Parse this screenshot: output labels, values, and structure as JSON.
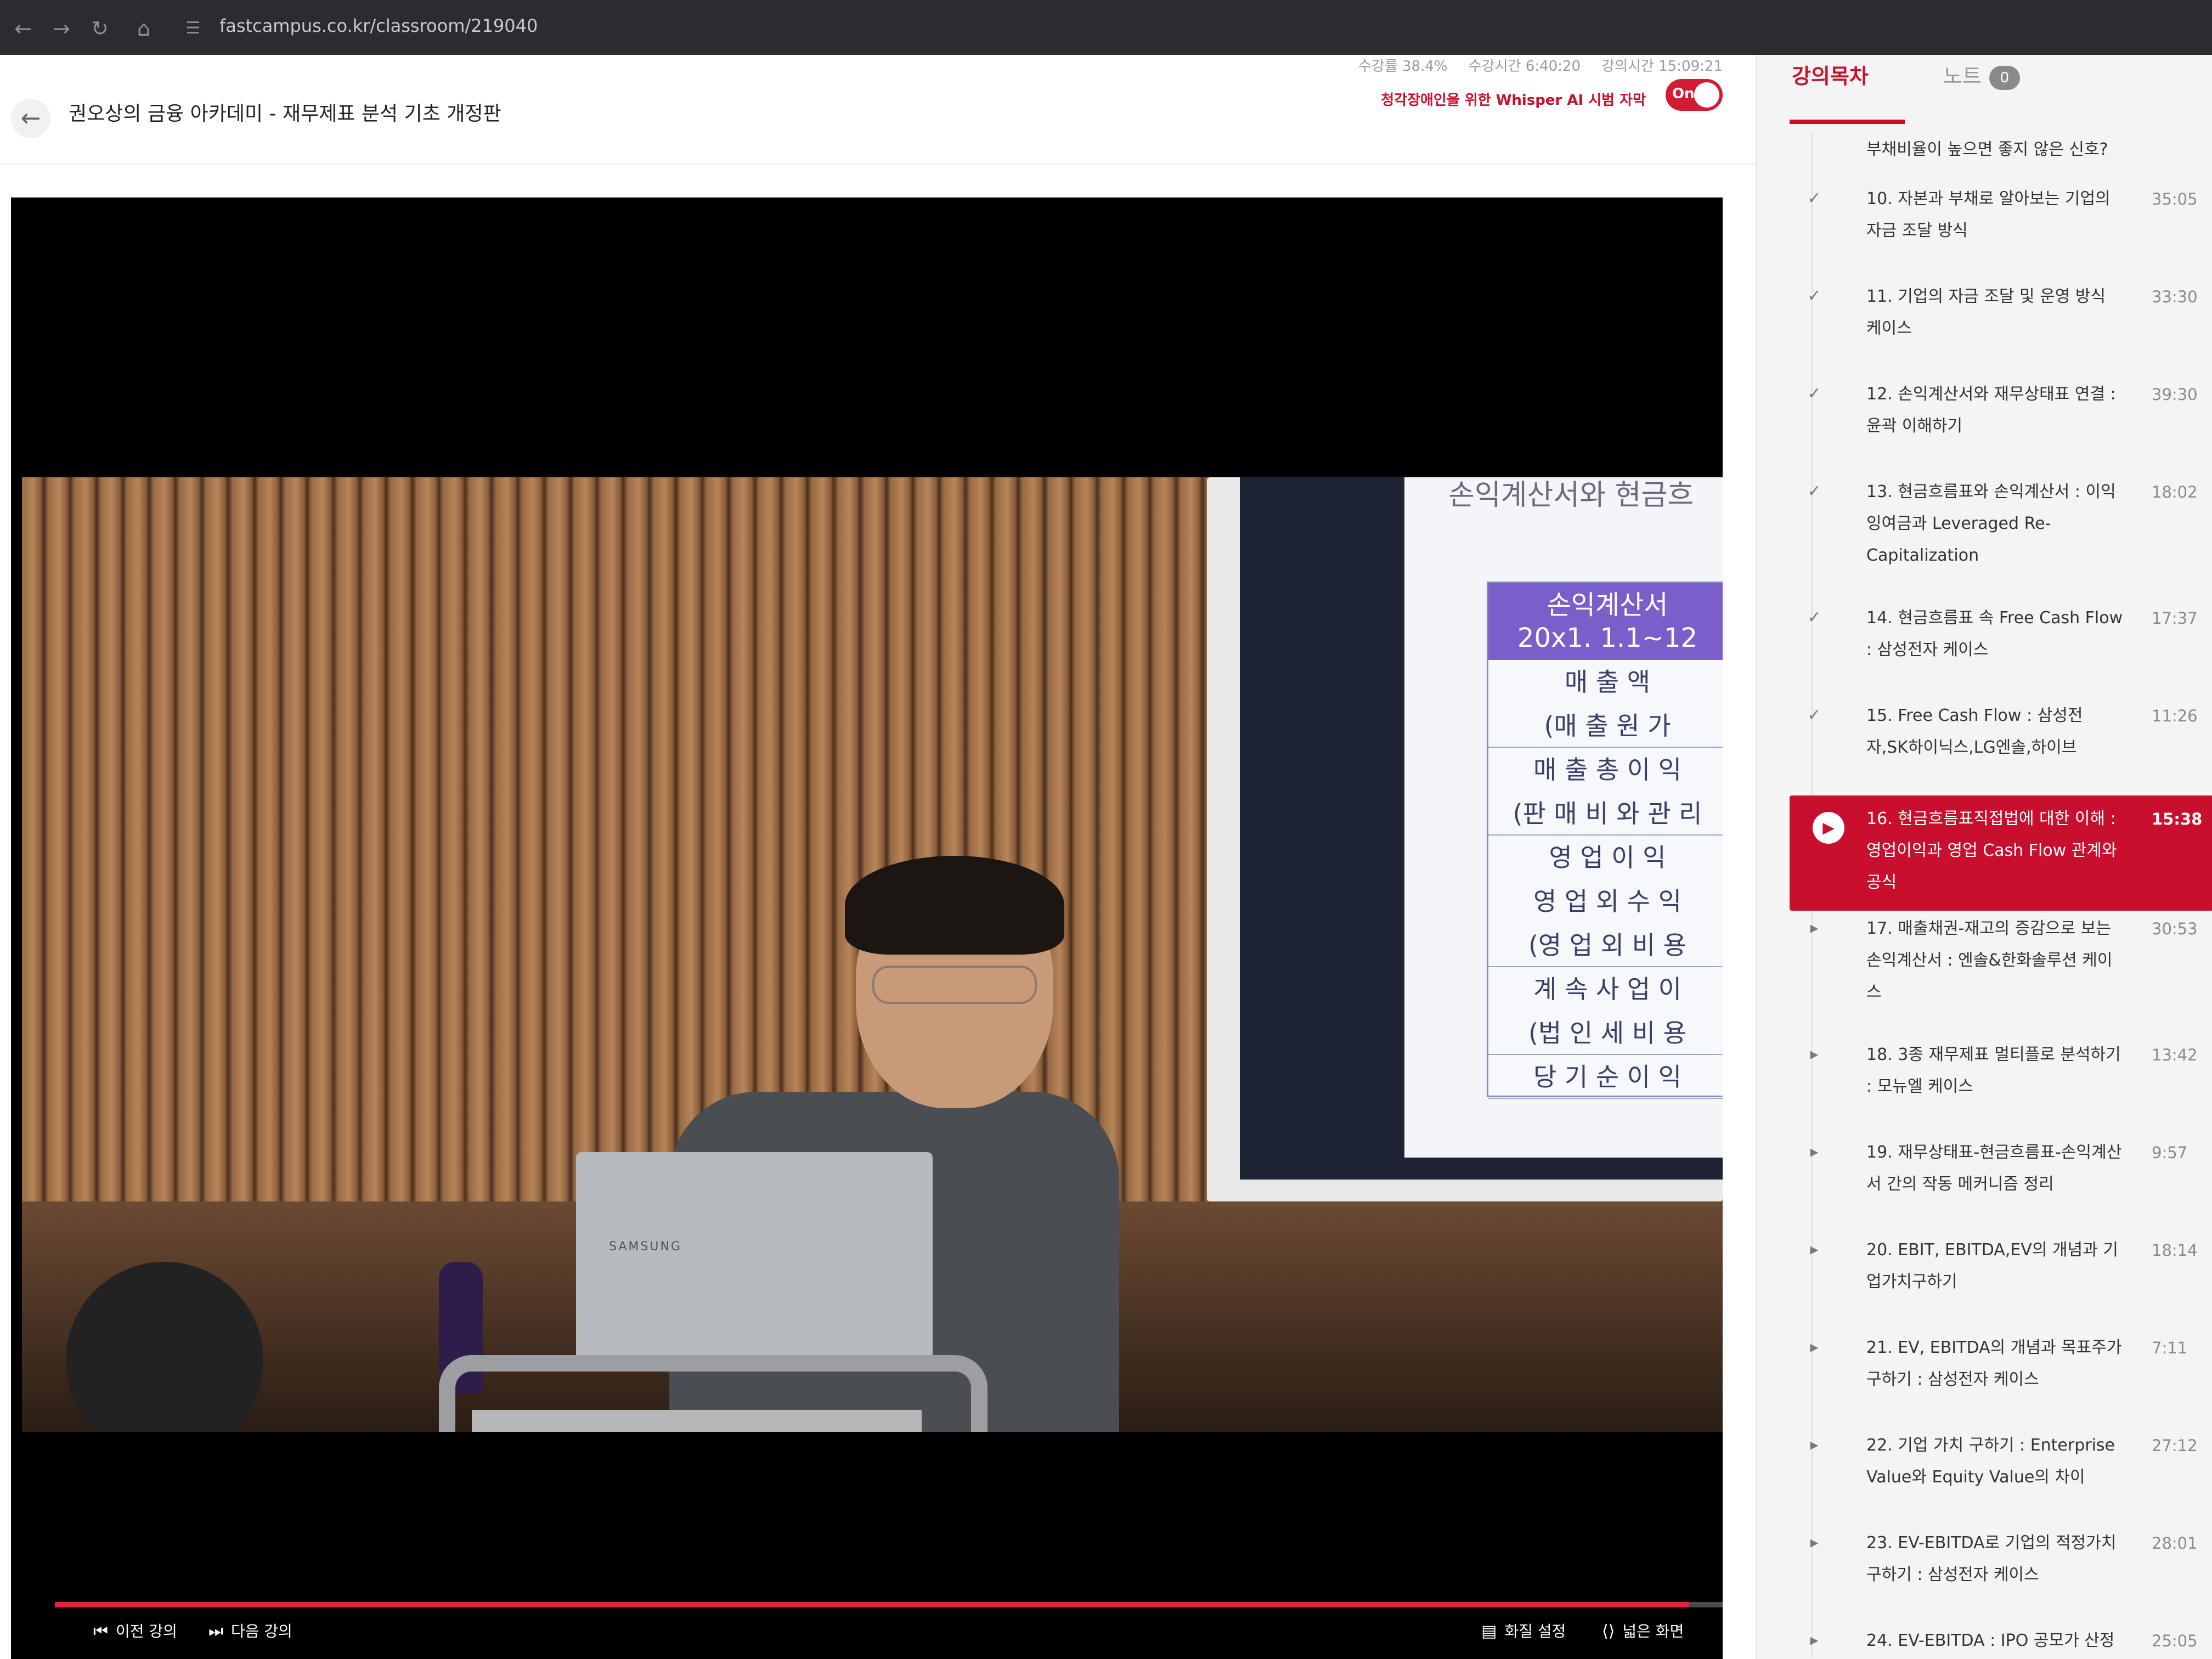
{
  "browser": {
    "url": "fastcampus.co.kr/classroom/219040",
    "icons": [
      "back-icon",
      "forward-icon",
      "refresh-icon",
      "home-icon",
      "site-settings-icon"
    ]
  },
  "header": {
    "course_title": "권오상의 금융 아카데미 - 재무제표 분석 기초 개정판",
    "stat_progress": "수강률 38.4%",
    "stat_watch_time": "수강시간 6:40:20",
    "stat_lecture_time": "강의시간 15:09:21",
    "whisper_caption": "청각장애인을 위한 Whisper AI 시범 자막",
    "toggle_label": "On"
  },
  "video": {
    "slide": {
      "title": "손익계산서와 현금흐",
      "header_line1": "손익계산서",
      "header_line2": "20x1. 1.1~12",
      "rows": [
        {
          "text": "매 출 액",
          "sub": true
        },
        {
          "text": "(매 출 원 가",
          "sub": false
        },
        {
          "text": "매 출 총 이 익",
          "sub": true
        },
        {
          "text": "(판 매 비 와 관 리",
          "sub": false
        },
        {
          "text": "영 업 이 익",
          "sub": true
        },
        {
          "text": "영 업 외 수 익",
          "sub": true
        },
        {
          "text": "(영 업 외 비 용",
          "sub": false
        },
        {
          "text": "계 속 사 업 이",
          "sub": true
        },
        {
          "text": "(법 인 세 비 용",
          "sub": false
        },
        {
          "text": "당 기 순 이 익",
          "sub": false
        }
      ],
      "laptop_brand": "SAMSUNG"
    },
    "progress_percent": 98
  },
  "controls": {
    "prev_label": "이전 강의",
    "next_label": "다음 강의",
    "quality_label": "화질 설정",
    "wide_label": "넓은 화면"
  },
  "sidebar": {
    "tab_toc": "강의목차",
    "tab_note": "노트",
    "note_count": "0",
    "lessons": [
      {
        "title": "부채비율이 높으면 좋지 않은 신호?",
        "duration": "",
        "status": "partial"
      },
      {
        "title": "10. 자본과 부채로 알아보는 기업의 자금 조달 방식",
        "duration": "35:05",
        "status": "done"
      },
      {
        "title": "11. 기업의 자금 조달 및 운영 방식 케이스",
        "duration": "33:30",
        "status": "done"
      },
      {
        "title": "12. 손익계산서와 재무상태표 연결 : 윤곽 이해하기",
        "duration": "39:30",
        "status": "done"
      },
      {
        "title": "13. 현금흐름표와 손익계산서 : 이익잉여금과 Leveraged Re-Capitalization",
        "duration": "18:02",
        "status": "done"
      },
      {
        "title": "14. 현금흐름표 속 Free Cash Flow : 삼성전자 케이스",
        "duration": "17:37",
        "status": "done"
      },
      {
        "title": "15. Free Cash Flow : 삼성전자,SK하이닉스,LG엔솔,하이브",
        "duration": "11:26",
        "status": "done"
      },
      {
        "title": "16. 현금흐름표직접법에 대한 이해 : 영업이익과 영업 Cash Flow 관계와 공식",
        "duration": "15:38",
        "status": "active"
      },
      {
        "title": "17. 매출채권-재고의 증감으로 보는 손익계산서 : 엔솔&한화솔루션 케이스",
        "duration": "30:53",
        "status": "todo"
      },
      {
        "title": "18. 3종 재무제표 멀티플로 분석하기 : 모뉴엘 케이스",
        "duration": "13:42",
        "status": "todo"
      },
      {
        "title": "19. 재무상태표-현금흐름표-손익계산서 간의 작동 메커니즘 정리",
        "duration": "9:57",
        "status": "todo"
      },
      {
        "title": "20. EBIT, EBITDA,EV의 개념과 기업가치구하기",
        "duration": "18:14",
        "status": "todo"
      },
      {
        "title": "21. EV, EBITDA의 개념과 목표주가구하기 : 삼성전자 케이스",
        "duration": "7:11",
        "status": "todo"
      },
      {
        "title": "22. 기업 가치 구하기 : Enterprise Value와 Equity Value의 차이",
        "duration": "27:12",
        "status": "todo"
      },
      {
        "title": "23. EV-EBITDA로 기업의 적정가치 구하기 : 삼성전자 케이스",
        "duration": "28:01",
        "status": "todo"
      },
      {
        "title": "24. EV-EBITDA : IPO 공모가 산정",
        "duration": "25:05",
        "status": "todo"
      }
    ]
  }
}
